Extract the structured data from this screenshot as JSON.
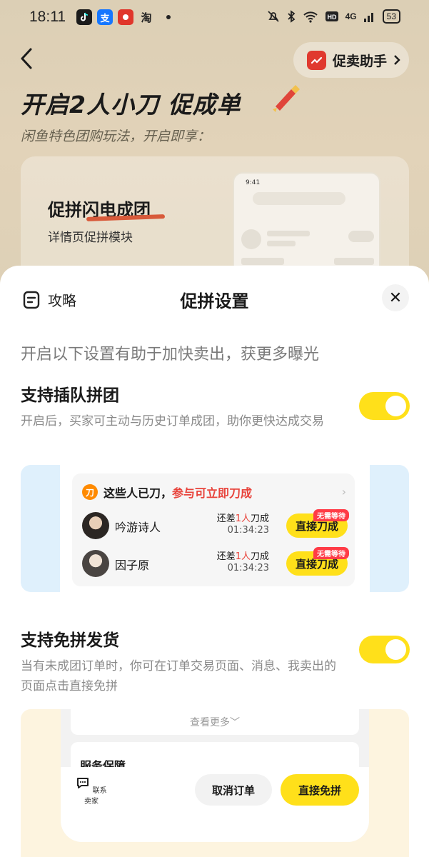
{
  "status_bar": {
    "time": "18:11",
    "apps": [
      "douyin-icon",
      "alipay-icon",
      "red-app-icon",
      "taobao-icon"
    ],
    "alipay_glyph": "支",
    "taobao_glyph": "淘",
    "network": "4G",
    "battery": "53"
  },
  "header": {
    "assistant_label": "促卖助手",
    "hero_title": "开启2人小刀 促成单",
    "hero_subtitle": "闲鱼特色团购玩法，开启即享：",
    "feature_title": "促拼闪电成团",
    "feature_subtitle": "详情页促拼模块",
    "mock_time": "9:41"
  },
  "sheet": {
    "guide_label": "攻略",
    "title": "促拼设置",
    "close_glyph": "✕",
    "intro": "开启以下设置有助于加快卖出，获更多曝光",
    "option1": {
      "title": "支持插队拼团",
      "desc": "开启后，买家可主动与历史订单成团，助你更快达成交易",
      "enabled": true
    },
    "option2": {
      "title": "支持免拼发货",
      "desc": "当有未成团订单时，你可在订单交易页面、消息、我卖出的页面点击直接免拼",
      "enabled": true
    }
  },
  "preview1": {
    "badge_glyph": "刀",
    "head_prefix": "这些人已刀，",
    "head_highlight": "参与可立即刀成",
    "chevron": "›",
    "rows": [
      {
        "name": "吟游诗人",
        "need_prefix": "还差",
        "need_num": "1人",
        "need_suffix": "刀成",
        "timer": "01:34:23",
        "button": "直接刀成",
        "tag": "无需等待"
      },
      {
        "name": "因子原",
        "need_prefix": "还差",
        "need_num": "1人",
        "need_suffix": "刀成",
        "timer": "01:34:23",
        "button": "直接刀成",
        "tag": "无需等待"
      }
    ]
  },
  "preview2": {
    "see_more": "查看更多﹀",
    "service_label": "服务保障",
    "contact_label": "联系卖家",
    "cancel_label": "取消订单",
    "direct_label": "直接免拼"
  }
}
